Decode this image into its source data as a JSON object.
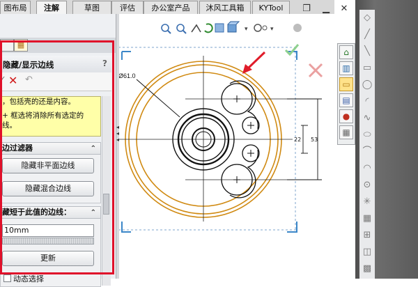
{
  "tabs": [
    "图布局",
    "注解",
    "草图",
    "评估",
    "办公室产品",
    "沐风工具箱",
    "KYTool"
  ],
  "active_tab": "注解",
  "window_controls": [
    "restore-icon",
    "minimize-icon",
    "close-icon"
  ],
  "view_toolbar": [
    "zoom-to-fit-icon",
    "zoom-area-icon",
    "previous-view-icon",
    "rebuild-icon",
    "section-view-icon",
    "view-orientation-icon",
    "display-style-icon",
    "hide-show-icon",
    "appearance-icon"
  ],
  "property_manager": {
    "title": "隐藏/显示边线",
    "help": "?",
    "actions": {
      "ok_icon": "checkmark-icon",
      "cancel_icon": "close-x-icon",
      "undo_icon": "undo-icon"
    },
    "message_lines": [
      "，包括壳的还是内容。",
      "+ 框选将消除所有选定的",
      "线。"
    ],
    "filter_section": {
      "title": "边过滤器",
      "buttons": [
        "隐藏非平面边线",
        "隐藏混合边线"
      ]
    },
    "length_section": {
      "title": "藏短于此值的边线：",
      "value": "10mm",
      "update_button": "更新",
      "dynamic_label": "动态选择"
    }
  },
  "drawing": {
    "dimensions": {
      "diameter": "Ø61.0",
      "inner": "22",
      "outer": "53"
    },
    "colors": {
      "outline": "#d08a12",
      "geometry": "#000000",
      "frame": "#3a86c8",
      "arrow": "#e01c2a",
      "cancel": "#e8a0a0"
    }
  },
  "task_pane_icons": [
    "home-icon",
    "design-library-icon",
    "file-explorer-icon",
    "view-palette-icon",
    "appearances-icon",
    "custom-properties-icon"
  ],
  "sketch_toolbar_icons": [
    "smart-dimension-icon",
    "line-icon",
    "rectangle-icon",
    "circle-icon",
    "arc-icon",
    "spline-icon",
    "ellipse-icon",
    "fillet-icon",
    "point-icon",
    "text-icon",
    "trim-icon",
    "convert-icon",
    "offset-icon",
    "mirror-icon",
    "pattern-icon",
    "move-icon"
  ]
}
